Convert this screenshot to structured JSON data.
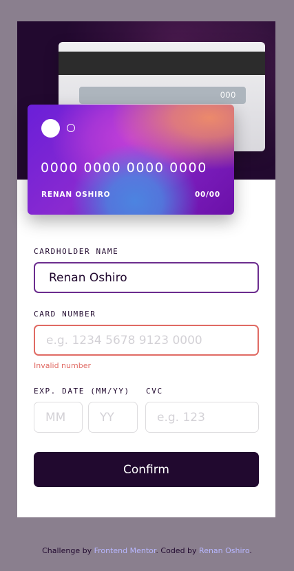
{
  "card_back": {
    "cvc": "000"
  },
  "card_front": {
    "number": "0000 0000 0000 0000",
    "name": "RENAN OSHIRO",
    "expiry": "00/00"
  },
  "form": {
    "cardholder_label": "CARDHOLDER NAME",
    "cardholder_value": "Renan Oshiro",
    "number_label": "CARD NUMBER",
    "number_placeholder": "e.g. 1234 5678 9123 0000",
    "number_error": "Invalid number",
    "exp_label": "EXP. DATE (MM/YY)",
    "mm_placeholder": "MM",
    "yy_placeholder": "YY",
    "cvc_label": "CVC",
    "cvc_placeholder": "e.g. 123",
    "confirm_label": "Confirm"
  },
  "footer": {
    "prefix": "Challenge by ",
    "link1": "Frontend Mentor",
    "middle": ". Coded by ",
    "link2": "Renan Oshiro",
    "suffix": "."
  },
  "colors": {
    "page_bg": "#8a7f8e",
    "hero_bg": "#22092f",
    "accent_dark": "#21092f",
    "error": "#e06a63",
    "active_border": "#6b2c8e",
    "link": "#b7b6ff"
  },
  "icons": [
    "card-chip-circle-icon",
    "card-chip-ring-icon"
  ]
}
